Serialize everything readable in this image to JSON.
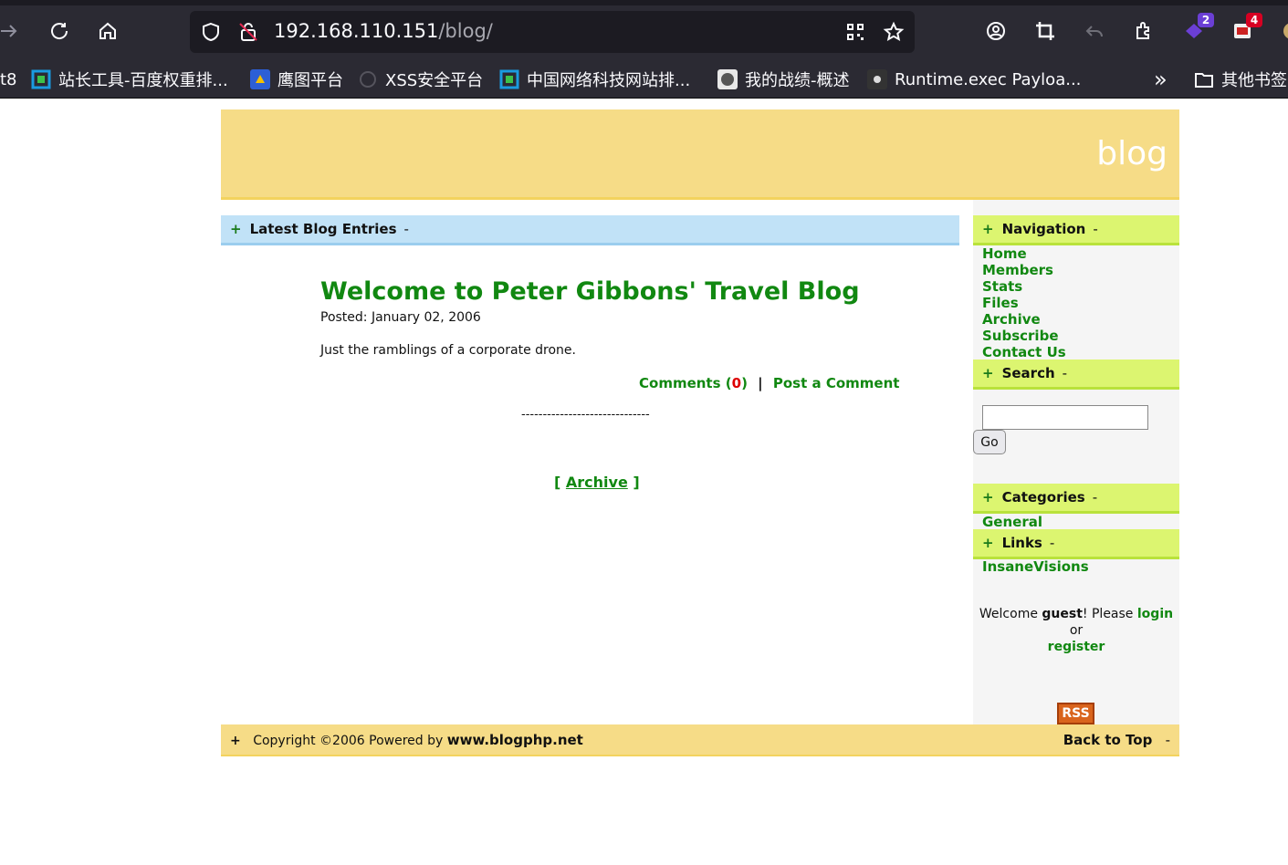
{
  "browser": {
    "url_host": "192.168.110.151",
    "url_path": "/blog/",
    "extension_badges": {
      "ext_a": "2",
      "ext_b": "4"
    },
    "bookmarks": [
      {
        "label": "t8",
        "icon": "none"
      },
      {
        "label": "站长工具-百度权重排...",
        "icon": "chart-icon"
      },
      {
        "label": "鹰图平台",
        "icon": "eagle-icon"
      },
      {
        "label": "XSS安全平台",
        "icon": "globe-icon"
      },
      {
        "label": "中国网络科技网站排...",
        "icon": "chart-icon"
      },
      {
        "label": "我的战绩-概述",
        "icon": "avatar-icon"
      },
      {
        "label": "Runtime.exec Payloa...",
        "icon": "spider-icon"
      }
    ],
    "other_bookmarks": "其他书签",
    "overflow_glyph": "»"
  },
  "site": {
    "title": "blog"
  },
  "main": {
    "section_title": "Latest Blog Entries",
    "plus": "+",
    "minus": "-",
    "post": {
      "title": "Welcome to Peter Gibbons' Travel Blog",
      "posted": "Posted: January 02, 2006",
      "body": "Just the ramblings of a corporate drone.",
      "comments_label": "Comments",
      "comments_open": "(",
      "comments_count": "0",
      "comments_close": ")",
      "divider": "|",
      "post_comment_label": "Post a Comment",
      "separator": "------------------------------"
    },
    "archive_open": "[",
    "archive_label": "Archive",
    "archive_close": "]"
  },
  "sidebar": {
    "navigation_title": "Navigation",
    "nav_items": [
      "Home",
      "Members",
      "Stats",
      "Files",
      "Archive",
      "Subscribe",
      "Contact Us"
    ],
    "search_title": "Search",
    "search_value": "",
    "go_label": "Go",
    "categories_title": "Categories",
    "categories": [
      "General"
    ],
    "links_title": "Links",
    "links": [
      "InsaneVisions"
    ],
    "welcome_prefix": "Welcome",
    "welcome_user": "guest",
    "welcome_mid": "! Please",
    "login_label": "login",
    "or_label": "or",
    "register_label": "register",
    "rss_label": "RSS"
  },
  "footer": {
    "plus": "+",
    "copyright": "Copyright ©2006 Powered by",
    "powered_by": "www.blogphp.net",
    "back_to_top": "Back to Top",
    "minus": "-"
  },
  "colors": {
    "header_bg": "#f6dc87",
    "latest_bar_bg": "#c1e2f7",
    "sidebar_bar_bg": "#dcf570",
    "link_green": "#118811",
    "comment_count_red": "#dd0000",
    "rss_orange": "#d9641c"
  }
}
